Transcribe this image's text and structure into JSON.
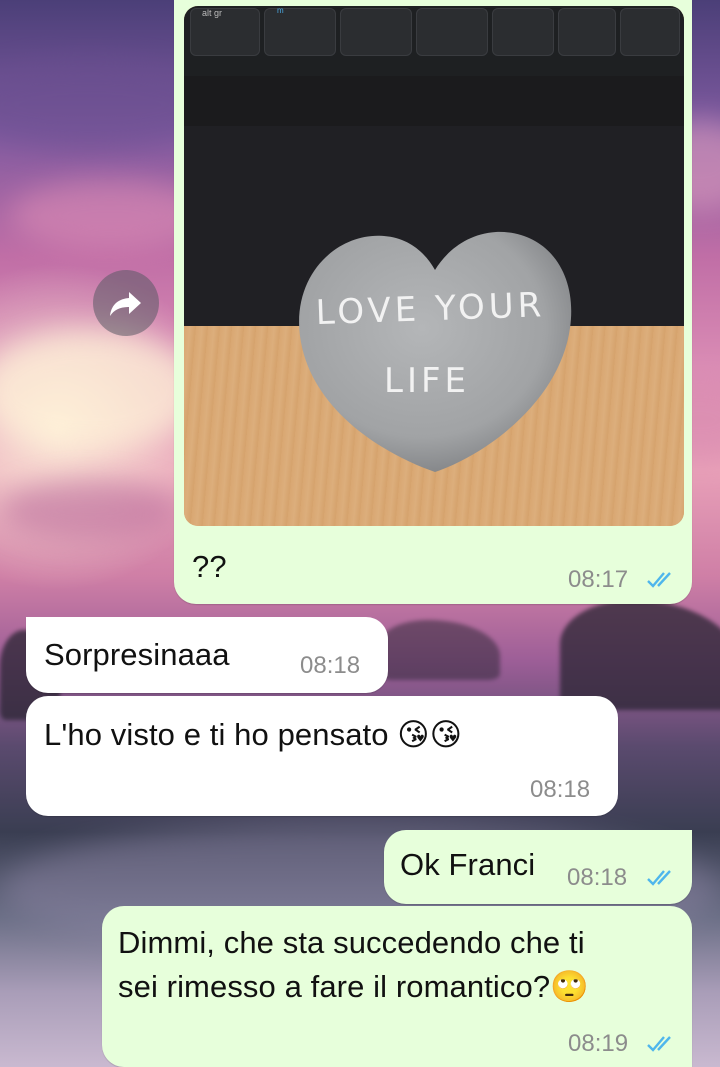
{
  "chat": {
    "messages": [
      {
        "type": "image",
        "caption": "??",
        "time": "08:17",
        "direction": "outgoing",
        "status": "read",
        "image_text_lines": [
          "LOVE YOUR",
          "LIFE"
        ],
        "keyboard_labels": [
          "alt gr",
          "m"
        ]
      },
      {
        "type": "text",
        "text": "Sorpresinaaa",
        "time": "08:18",
        "direction": "incoming"
      },
      {
        "type": "text",
        "text": "L'ho visto e ti ho pensato 😘😘",
        "time": "08:18",
        "direction": "incoming"
      },
      {
        "type": "text",
        "text": "Ok Franci",
        "time": "08:18",
        "direction": "outgoing",
        "status": "read"
      },
      {
        "type": "text",
        "text_lines": [
          "Dimmi, che sta succedendo che ti",
          "sei rimesso a fare il romantico?🙄"
        ],
        "time": "08:19",
        "direction": "outgoing",
        "status": "read"
      }
    ]
  },
  "icons": {
    "forward": "forward-arrow-icon",
    "read_receipt": "double-check-icon"
  },
  "colors": {
    "outgoing_bubble": "#e7ffdb",
    "incoming_bubble": "#ffffff",
    "read_tick": "#4fb6ec",
    "time_text": "#8c8c8c"
  }
}
